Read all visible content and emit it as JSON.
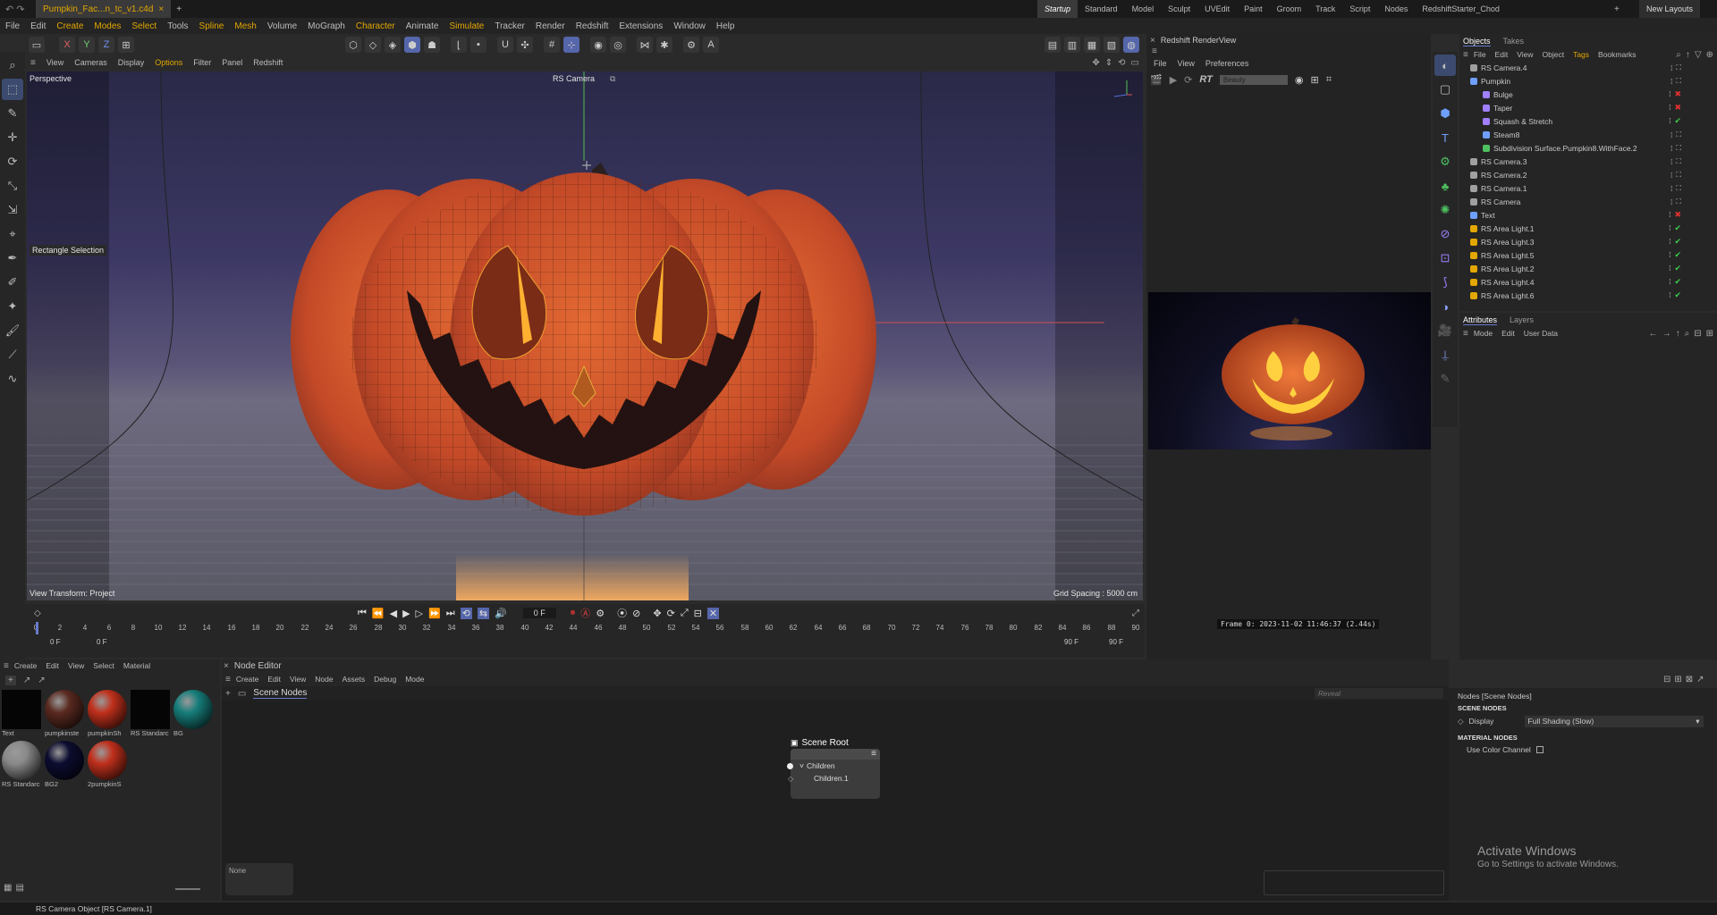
{
  "title_bar": {
    "tab_name": "Pumpkin_Fac...n_tc_v1.c4d",
    "layouts": [
      "Startup",
      "Standard",
      "Model",
      "Sculpt",
      "UVEdit",
      "Paint",
      "Groom",
      "Track",
      "Script",
      "Nodes",
      "RedshiftStarter_Chod"
    ],
    "new_layouts": "New Layouts"
  },
  "menu": [
    "File",
    "Edit",
    "Create",
    "Modes",
    "Select",
    "Tools",
    "Spline",
    "Mesh",
    "Volume",
    "MoGraph",
    "Character",
    "Animate",
    "Simulate",
    "Tracker",
    "Render",
    "Redshift",
    "Extensions",
    "Window",
    "Help"
  ],
  "axis_buttons": [
    "X",
    "Y",
    "Z"
  ],
  "viewport_menu": [
    "View",
    "Cameras",
    "Display",
    "Options",
    "Filter",
    "Panel",
    "Redshift"
  ],
  "viewport": {
    "projection": "Perspective",
    "camera": "RS Camera",
    "tool_label": "Rectangle Selection",
    "view_transform": "View Transform: Project",
    "grid_spacing": "Grid Spacing : 5000 cm"
  },
  "timeline": {
    "current_frame": "0 F",
    "ticks": [
      "0",
      "2",
      "4",
      "6",
      "8",
      "10",
      "12",
      "14",
      "16",
      "18",
      "20",
      "22",
      "24",
      "26",
      "28",
      "30",
      "32",
      "34",
      "36",
      "38",
      "40",
      "42",
      "44",
      "46",
      "48",
      "50",
      "52",
      "54",
      "56",
      "58",
      "60",
      "62",
      "64",
      "66",
      "68",
      "70",
      "72",
      "74",
      "76",
      "78",
      "80",
      "82",
      "84",
      "86",
      "88",
      "90"
    ],
    "start_a": "0 F",
    "start_b": "0 F",
    "end_a": "90 F",
    "end_b": "90 F"
  },
  "render_view": {
    "title": "Redshift RenderView",
    "menu": [
      "File",
      "View",
      "Preferences"
    ],
    "rt_label": "RT",
    "aov": "Beauty",
    "frame_info": "Frame 0: 2023-11-02 11:46:37 (2.44s)"
  },
  "objects_panel": {
    "tabs": [
      "Objects",
      "Takes"
    ],
    "menu": [
      "File",
      "Edit",
      "View",
      "Object",
      "Tags",
      "Bookmarks"
    ],
    "items": [
      {
        "name": "RS Camera.4",
        "status": "",
        "depth": 0
      },
      {
        "name": "Pumpkin",
        "status": "",
        "depth": 0
      },
      {
        "name": "Bulge",
        "status": "x",
        "depth": 1
      },
      {
        "name": "Taper",
        "status": "x",
        "depth": 1
      },
      {
        "name": "Squash & Stretch",
        "status": "check",
        "depth": 1
      },
      {
        "name": "Steam8",
        "status": "",
        "depth": 1
      },
      {
        "name": "Subdivision Surface.Pumpkin8.WithFace.2",
        "status": "",
        "depth": 1
      },
      {
        "name": "RS Camera.3",
        "status": "",
        "depth": 0
      },
      {
        "name": "RS Camera.2",
        "status": "",
        "depth": 0
      },
      {
        "name": "RS Camera.1",
        "status": "",
        "depth": 0
      },
      {
        "name": "RS Camera",
        "status": "",
        "depth": 0
      },
      {
        "name": "Text",
        "status": "x",
        "depth": 0
      },
      {
        "name": "RS Area Light.1",
        "status": "check",
        "depth": 0
      },
      {
        "name": "RS Area Light.3",
        "status": "check",
        "depth": 0
      },
      {
        "name": "RS Area Light.5",
        "status": "check",
        "depth": 0
      },
      {
        "name": "RS Area Light.2",
        "status": "check",
        "depth": 0
      },
      {
        "name": "RS Area Light.4",
        "status": "check",
        "depth": 0
      },
      {
        "name": "RS Area Light.6",
        "status": "check",
        "depth": 0
      }
    ]
  },
  "attributes_panel": {
    "tabs": [
      "Attributes",
      "Layers"
    ],
    "menu": [
      "Mode",
      "Edit",
      "User Data"
    ]
  },
  "material_panel": {
    "menu": [
      "Create",
      "Edit",
      "View",
      "Select",
      "Material"
    ],
    "materials": [
      {
        "name": "Text",
        "color": "#050505"
      },
      {
        "name": "pumpkinste",
        "color": "#5a2a20"
      },
      {
        "name": "pumpkinSh",
        "color": "#c0301c"
      },
      {
        "name": "RS Standarc",
        "color": "#050505"
      },
      {
        "name": "BG",
        "color": "#167d7a"
      },
      {
        "name": "RS Standarc",
        "color": "#8a8a8a"
      },
      {
        "name": "BG2",
        "color": "#0c0c30"
      },
      {
        "name": "2pumpkinS",
        "color": "#c0301c"
      }
    ]
  },
  "node_editor": {
    "title": "Node Editor",
    "menu": [
      "Create",
      "Edit",
      "View",
      "Node",
      "Assets",
      "Debug",
      "Mode"
    ],
    "breadcrumb": "Scene Nodes",
    "search_placeholder": "Reveal",
    "node_title": "Scene Root",
    "port_1": "Children",
    "port_2": "Children.1",
    "none_label": "None"
  },
  "node_attributes": {
    "title": "Nodes [Scene Nodes]",
    "scene_nodes_heading": "SCENE NODES",
    "display_label": "Display",
    "display_value": "Full Shading (Slow)",
    "material_nodes_heading": "MATERIAL NODES",
    "use_color_channel": "Use Color Channel"
  },
  "watermark": {
    "line1": "Activate Windows",
    "line2": "Go to Settings to activate Windows."
  },
  "status_bar": "RS Camera Object [RS Camera.1]",
  "colors": {
    "accent": "#e2a700",
    "selected": "#5566aa",
    "pumpkin": "#d9582a"
  }
}
